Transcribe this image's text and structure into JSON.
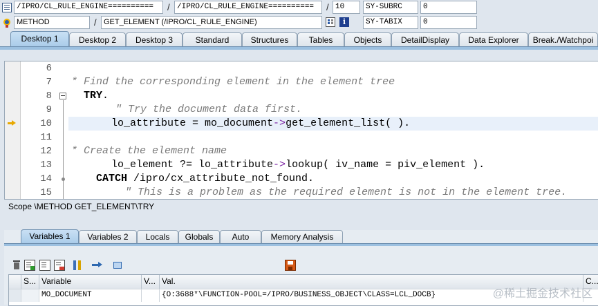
{
  "header": {
    "row1": {
      "field1": "/IPRO/CL_RULE_ENGINE==========",
      "separator1": "/",
      "field2": "/IPRO/CL_RULE_ENGINE==========",
      "separator2": "/",
      "line": "10",
      "var_name": "SY-SUBRC",
      "var_value": "0"
    },
    "row2": {
      "event_type": "METHOD",
      "separator": "/",
      "event_name": "GET_ELEMENT (/IPRO/CL_RULE_ENGINE)",
      "var_name": "SY-TABIX",
      "var_value": "0"
    }
  },
  "tabs": [
    "Desktop 1",
    "Desktop 2",
    "Desktop 3",
    "Standard",
    "Structures",
    "Tables",
    "Objects",
    "DetailDisplay",
    "Data Explorer",
    "Break./Watchpoi"
  ],
  "editor": {
    "lines": [
      {
        "num": "6",
        "text": ""
      },
      {
        "num": "7",
        "text": "* Find the corresponding element in the element tree"
      },
      {
        "num": "8",
        "kw": "TRY",
        "rest": "."
      },
      {
        "num": "9",
        "text": "\" Try the document data first."
      },
      {
        "num": "10",
        "pre": "lo_attribute = mo_document",
        "op": "->",
        "post": "get_element_list( ).",
        "current": true
      },
      {
        "num": "11",
        "text": ""
      },
      {
        "num": "12",
        "text": "* Create the element name"
      },
      {
        "num": "13",
        "pre": "lo_element ?= lo_attribute",
        "op": "->",
        "post": "lookup( iv_name = piv_element )."
      },
      {
        "num": "14",
        "kw": "CATCH",
        "rest": " /ipro/cx_attribute_not_found."
      },
      {
        "num": "15",
        "text": "\" This is a problem as the required element is not in the element tree."
      }
    ]
  },
  "scope": "Scope \\METHOD GET_ELEMENT\\TRY",
  "var_tabs": [
    "Variables 1",
    "Variables 2",
    "Locals",
    "Globals",
    "Auto",
    "Memory Analysis"
  ],
  "grid": {
    "headers": [
      "S...",
      "Variable",
      "V...",
      "Val.",
      "C..."
    ],
    "rows": [
      {
        "variable": "MO_DOCUMENT",
        "value": "{O:3688*\\FUNCTION-POOL=/IPRO/BUSINESS_OBJECT\\CLASS=LCL_DOCB}"
      }
    ]
  },
  "watermark": "@稀土掘金技术社区"
}
